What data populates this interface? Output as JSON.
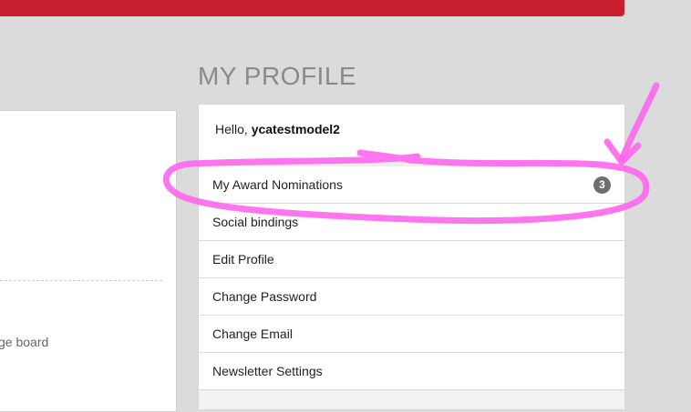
{
  "left_panel": {
    "partial_text": "ge board"
  },
  "profile": {
    "heading": "MY PROFILE",
    "greeting_prefix": "Hello, ",
    "username": "ycatestmodel2",
    "menu": [
      {
        "label": "My Award Nominations",
        "badge": "3"
      },
      {
        "label": "Social bindings"
      },
      {
        "label": "Edit Profile"
      },
      {
        "label": "Change Password"
      },
      {
        "label": "Change Email"
      },
      {
        "label": "Newsletter Settings"
      }
    ]
  },
  "colors": {
    "top_bar": "#c8202f",
    "background": "#dbdbdb",
    "badge": "#6f6f6f",
    "annotation": "#ff66ee"
  },
  "annotation": {
    "type": "hand-drawn circle and arrow highlighting My Award Nominations"
  }
}
